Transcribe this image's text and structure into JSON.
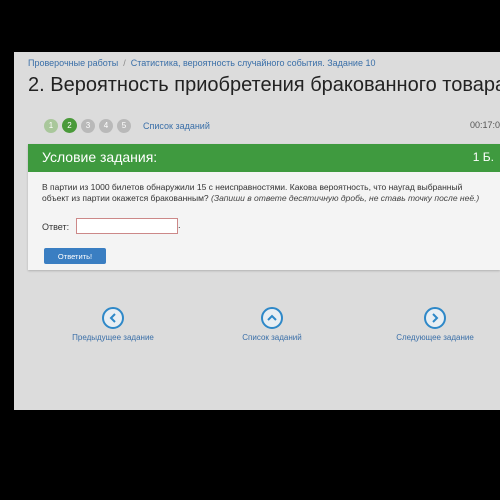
{
  "breadcrumb": {
    "root": "Проверочные работы",
    "section": "Статистика, вероятность случайного события. Задание 10"
  },
  "title": "2. Вероятность приобретения бракованного товара",
  "task_nav": {
    "steps": [
      "1",
      "2",
      "3",
      "4",
      "5"
    ],
    "current": 2,
    "list_link": "Список заданий",
    "timer": "00:17:0"
  },
  "card": {
    "title": "Условие задания:",
    "points": "1 Б.",
    "question_main": "В партии из 1000 билетов обнаружили 15 с неисправностями. Какова вероятность, что наугад выбранный объект из партии окажется бракованным?",
    "question_hint": "(Запиши в ответе десятичную дробь, не ставь точку после неё.)",
    "answer_label": "Ответ:",
    "answer_value": "",
    "answer_suffix": ".",
    "submit": "Ответить!"
  },
  "bottom_nav": {
    "prev": "Предыдущее задание",
    "list": "Список заданий",
    "next": "Следующее задание"
  },
  "colors": {
    "header_green": "#3f9a3f",
    "accent_blue": "#3a7ec2",
    "icon_blue": "#2e88c8"
  }
}
